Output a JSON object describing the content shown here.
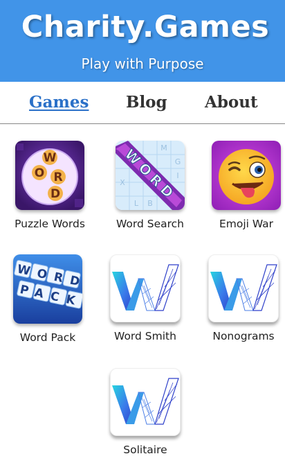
{
  "header": {
    "title": "Charity.Games",
    "tagline": "Play with Purpose"
  },
  "nav": {
    "items": [
      {
        "label": "Games",
        "active": true
      },
      {
        "label": "Blog",
        "active": false
      },
      {
        "label": "About",
        "active": false
      }
    ]
  },
  "games": [
    {
      "label": "Puzzle Words",
      "icon": "puzzle-words-icon"
    },
    {
      "label": "Word Search",
      "icon": "word-search-icon"
    },
    {
      "label": "Emoji War",
      "icon": "winking-emoji-icon"
    },
    {
      "label": "Word Pack",
      "icon": "word-pack-icon"
    },
    {
      "label": "Word Smith",
      "icon": "w-logo-icon"
    },
    {
      "label": "Nonograms",
      "icon": "w-logo-icon"
    },
    {
      "label": "Solitaire",
      "icon": "w-logo-icon"
    }
  ],
  "icon_text": {
    "puzzle_words": [
      "W",
      "O",
      "R",
      "D"
    ],
    "word_search": "WORD",
    "word_pack": [
      "WORD",
      "PACK"
    ]
  },
  "colors": {
    "header": "#4194e8",
    "nav_active": "#2a70c8",
    "nav_inactive": "#333333"
  }
}
